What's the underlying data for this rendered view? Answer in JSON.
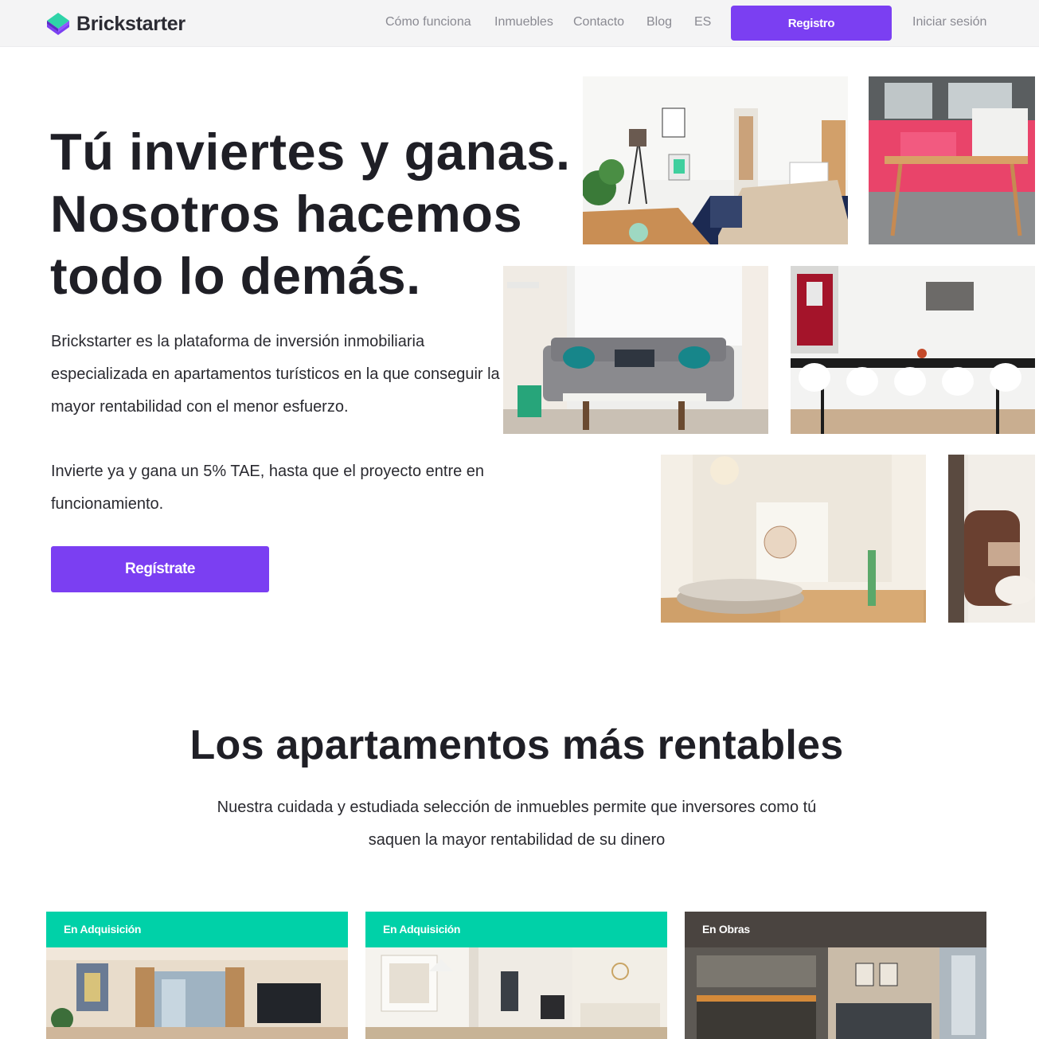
{
  "brand": {
    "name": "Brickstarter",
    "accent": "#7b3ff2",
    "mark_colors": [
      "#2ed3a8",
      "#7b3ff2"
    ]
  },
  "nav": {
    "links": [
      "Cómo funciona",
      "Inmuebles",
      "Contacto",
      "Blog",
      "ES"
    ],
    "register_label": "Registro",
    "login_label": "Iniciar sesión"
  },
  "hero": {
    "title_lines": [
      "Tú inviertes y ganas.",
      "Nosotros hacemos",
      "todo lo demás."
    ],
    "description": "Brickstarter es la plataforma de inversión inmobiliaria especializada en apartamentos turísticos en la que conseguir la mayor rentabilidad con el menor esfuerzo.",
    "offer": "Invierte ya y gana un 5% TAE, hasta que el proyecto entre en funcionamiento.",
    "cta_label": "Regístrate"
  },
  "section": {
    "title": "Los apartamentos más rentables",
    "subtitle": "Nuestra cuidada y estudiada selección de inmuebles permite que inversores como tú saquen la mayor rentabilidad de su dinero"
  },
  "cards": [
    {
      "badge": "En Adquisición",
      "band_color": "#00d1a8"
    },
    {
      "badge": "En Adquisición",
      "band_color": "#00d1a8"
    },
    {
      "badge": "En Obras",
      "band_color": "#4a4440"
    }
  ]
}
